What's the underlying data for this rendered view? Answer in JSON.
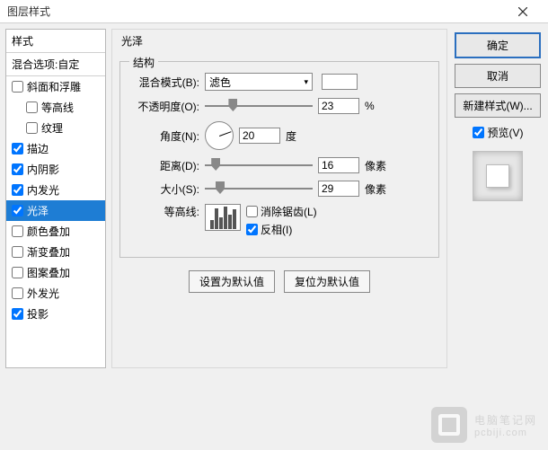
{
  "window": {
    "title": "图层样式"
  },
  "sidebar": {
    "header": "样式",
    "sub": "混合选项:自定",
    "items": [
      {
        "label": "斜面和浮雕",
        "checked": false,
        "indent": false
      },
      {
        "label": "等高线",
        "checked": false,
        "indent": true
      },
      {
        "label": "纹理",
        "checked": false,
        "indent": true
      },
      {
        "label": "描边",
        "checked": true,
        "indent": false
      },
      {
        "label": "内阴影",
        "checked": true,
        "indent": false
      },
      {
        "label": "内发光",
        "checked": true,
        "indent": false
      },
      {
        "label": "光泽",
        "checked": true,
        "indent": false,
        "selected": true
      },
      {
        "label": "颜色叠加",
        "checked": false,
        "indent": false
      },
      {
        "label": "渐变叠加",
        "checked": false,
        "indent": false
      },
      {
        "label": "图案叠加",
        "checked": false,
        "indent": false
      },
      {
        "label": "外发光",
        "checked": false,
        "indent": false
      },
      {
        "label": "投影",
        "checked": true,
        "indent": false
      }
    ]
  },
  "panel": {
    "title": "光泽",
    "group": "结构",
    "labels": {
      "blend": "混合模式(B):",
      "opacity": "不透明度(O):",
      "angle": "角度(N):",
      "distance": "距离(D):",
      "size": "大小(S):",
      "contour": "等高线:"
    },
    "blend_value": "滤色",
    "opacity_value": "23",
    "opacity_unit": "%",
    "angle_value": "20",
    "angle_unit": "度",
    "distance_value": "16",
    "distance_unit": "像素",
    "size_value": "29",
    "size_unit": "像素",
    "antialias_label": "消除锯齿(L)",
    "antialias_checked": false,
    "invert_label": "反相(I)",
    "invert_checked": true,
    "buttons": {
      "default": "设置为默认值",
      "reset": "复位为默认值"
    }
  },
  "right": {
    "ok": "确定",
    "cancel": "取消",
    "newstyle": "新建样式(W)...",
    "preview": "预览(V)",
    "preview_checked": true
  },
  "watermark": {
    "text": "电脑笔记网",
    "sub": "pcbiji.com"
  }
}
